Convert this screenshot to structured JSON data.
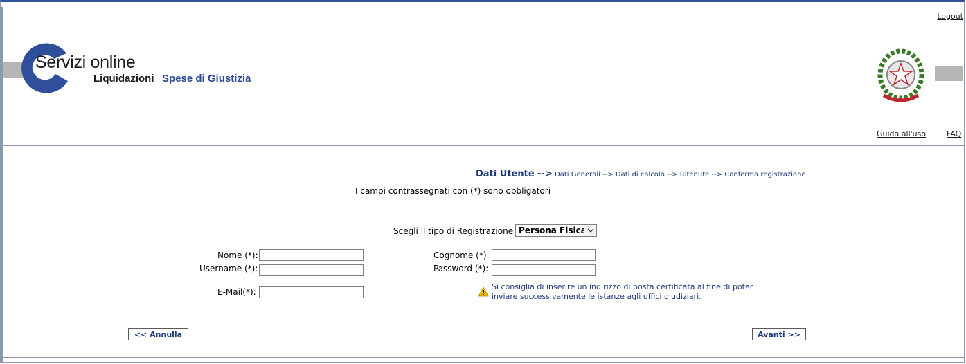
{
  "header": {
    "logout": "Logout",
    "logo_title": "Servizi online",
    "logo_sub1": "Liquidazioni",
    "logo_sub2": "Spese di Giustizia",
    "guida": "Guida all'uso",
    "faq": "FAQ"
  },
  "steps": {
    "current": "Dati Utente -->",
    "rest": "Dati Generali --> Dati di calcolo --> Ritenute --> Conferma registrazione"
  },
  "mandatory_note": "I campi contrassegnati con (*) sono obbligatori",
  "registration": {
    "label": "Scegli il tipo di Registrazione",
    "selected": "Persona Fisica"
  },
  "form": {
    "nome_label": "Nome (*):",
    "cognome_label": "Cognome (*):",
    "username_label": "Username (*):",
    "password_label": "Password (*):",
    "email_label": "E-Mail(*):",
    "nome_value": "",
    "cognome_value": "",
    "username_value": "",
    "password_value": "",
    "email_value": ""
  },
  "warning": {
    "line1": "Si consiglia di inserire un indirizzo di posta certificata al fine di poter",
    "line2": "inviare successivamente le istanze agli uffici giudiziari."
  },
  "buttons": {
    "annulla": "<< Annulla",
    "avanti": "Avanti >>"
  },
  "colors": {
    "frame_blue": "#2f4f9a",
    "text_blue": "#1f3a7a",
    "warning_yellow": "#f2b800"
  }
}
